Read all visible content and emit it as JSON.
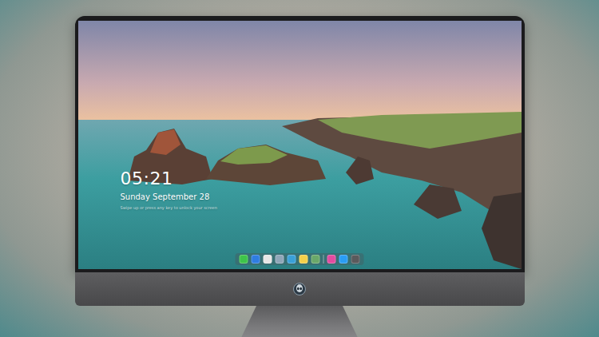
{
  "lock_screen": {
    "clock": "05:21",
    "date": "Sunday September 28",
    "hint": "Swipe up or press any key to unlock your screen"
  },
  "dock": {
    "apps": [
      {
        "color": "#3ec44a"
      },
      {
        "color": "#2f7de1"
      },
      {
        "color": "#e6e6e6"
      },
      {
        "color": "#8fa6b8"
      },
      {
        "color": "#3aa0d8"
      },
      {
        "color": "#f3d04a"
      },
      {
        "color": "#6aa86a"
      },
      {
        "color": "#e24ca0"
      },
      {
        "color": "#2a9df4"
      },
      {
        "color": "#5a5a5c"
      }
    ]
  }
}
